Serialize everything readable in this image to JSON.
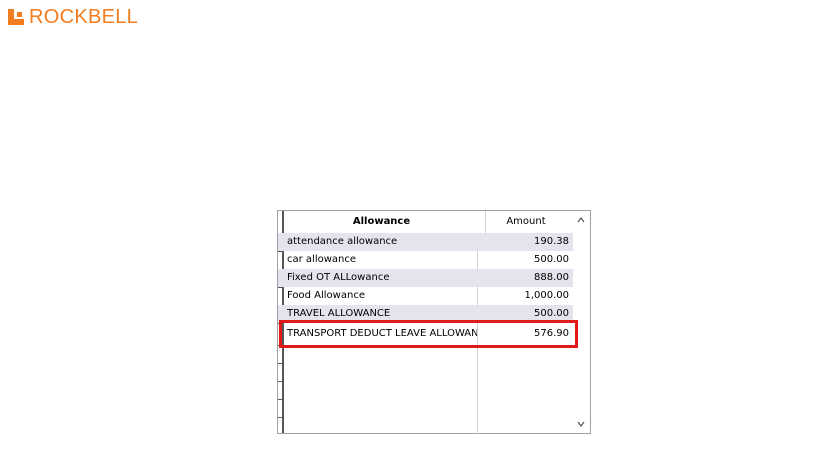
{
  "brand": {
    "name": "ROCKBELL",
    "color": "#f07d20"
  },
  "grid": {
    "columns": {
      "allowance": "Allowance",
      "amount": "Amount"
    },
    "rows": [
      {
        "allowance": "attendance allowance",
        "amount": "190.38"
      },
      {
        "allowance": "car allowance",
        "amount": "500.00"
      },
      {
        "allowance": "Fixed OT ALLowance",
        "amount": "888.00"
      },
      {
        "allowance": "Food Allowance",
        "amount": "1,000.00"
      },
      {
        "allowance": "TRAVEL ALLOWANCE",
        "amount": "500.00"
      },
      {
        "allowance": "TRANSPORT DEDUCT LEAVE ALLOWANCE",
        "amount": "576.90"
      }
    ],
    "selected_row_index": 0,
    "highlighted_row_index": 5,
    "highlight_color": "#e0191b"
  },
  "icons": {
    "scroll_up": "chevron-up-icon",
    "scroll_down": "chevron-down-icon",
    "current_row": "row-pointer-icon"
  }
}
